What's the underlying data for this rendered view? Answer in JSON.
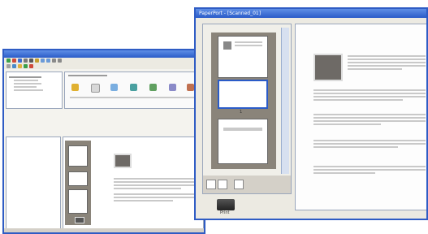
{
  "back_window": {
    "title": "",
    "toolbar_icons": [
      "green-arrow-icon",
      "forward-icon",
      "home-icon",
      "search-icon",
      "print-icon",
      "scanner-icon",
      "rotate-left-icon",
      "rotate-right-icon",
      "zoom-in-icon",
      "zoom-out-icon",
      "cut-icon",
      "copy-icon",
      "paste-icon"
    ],
    "ribbon_items": [
      "item-1",
      "item-2",
      "item-3",
      "item-4",
      "item-5",
      "item-6",
      "item-7"
    ]
  },
  "front_window": {
    "title": "PaperPort - [Scanned_01]",
    "page_number": "1",
    "page_input_value": "",
    "desktop_icon_label": "Print"
  }
}
